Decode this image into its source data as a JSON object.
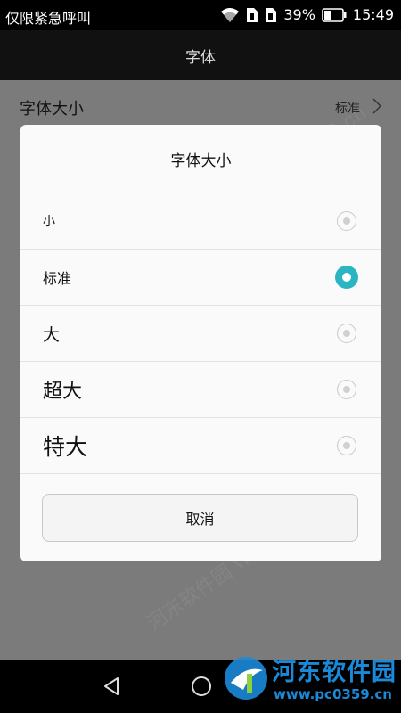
{
  "status_bar": {
    "carrier": "仅限紧急呼叫",
    "battery_percent": "39%",
    "time": "15:49",
    "icons": [
      "wifi-icon",
      "sim1-icon",
      "sim2-icon",
      "battery-icon"
    ]
  },
  "title_bar": {
    "title": "字体"
  },
  "background_settings": {
    "font_size_label": "字体大小",
    "font_size_value": "标准"
  },
  "dialog": {
    "title": "字体大小",
    "options": [
      {
        "label": "小",
        "selected": false
      },
      {
        "label": "标准",
        "selected": true
      },
      {
        "label": "大",
        "selected": false
      },
      {
        "label": "超大",
        "selected": false
      },
      {
        "label": "特大",
        "selected": false
      }
    ],
    "cancel_label": "取消",
    "accent_color": "#2bb5c2"
  },
  "nav_bar": {
    "icons": [
      "back-icon",
      "home-icon"
    ]
  },
  "watermark": {
    "brand": "河东软件园",
    "url": "www.pc0359.cn"
  }
}
